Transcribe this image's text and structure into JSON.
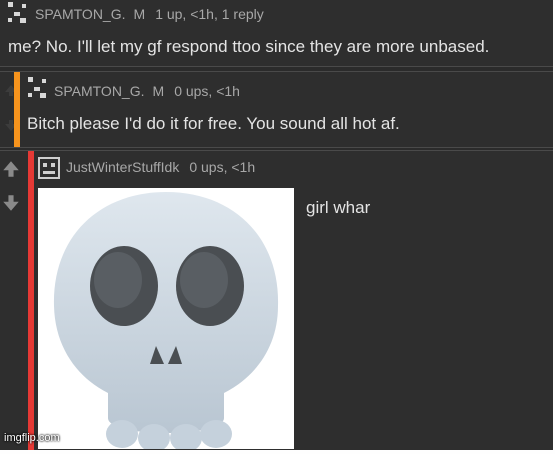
{
  "comments": [
    {
      "username": "SPAMTON_G.",
      "flag": "M",
      "stats": "1 up, <1h, 1 reply",
      "text": "me? No. I'll let my gf respond ttoo since they are more unbased."
    },
    {
      "username": "SPAMTON_G.",
      "flag": "M",
      "stats": "0 ups, <1h",
      "text": "Bitch please I'd do it for free. You sound all hot af."
    },
    {
      "username": "JustWinterStuffIdk",
      "stats": "0 ups, <1h",
      "text": "girl whar",
      "image": "skull-emoji"
    }
  ],
  "watermark": "imgflip.com",
  "colors": {
    "background": "#2e2e2e",
    "text": "#e4e4e4",
    "meta": "#a8a8a8",
    "reply_bar_orange": "#f7941d",
    "reply_bar_red": "#e53935"
  }
}
